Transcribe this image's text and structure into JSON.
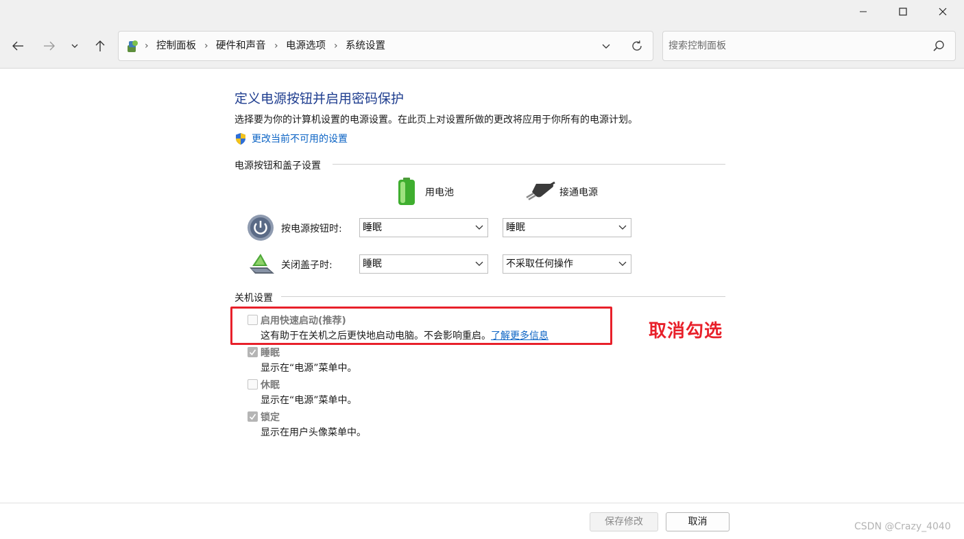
{
  "address": {
    "crumbs": [
      "控制面板",
      "硬件和声音",
      "电源选项",
      "系统设置"
    ],
    "separator": "›"
  },
  "search": {
    "placeholder": "搜索控制面板"
  },
  "icons": {
    "back": "back-arrow-icon",
    "forward": "forward-arrow-icon",
    "recent": "chevron-down-icon",
    "up": "up-arrow-icon",
    "refresh": "refresh-icon",
    "search": "search-icon",
    "minimize": "minimize-icon",
    "maximize": "maximize-icon",
    "close": "close-icon"
  },
  "page": {
    "title": "定义电源按钮并启用密码保护",
    "description": "选择要为你的计算机设置的电源设置。在此页上对设置所做的更改将应用于你所有的电源计划。",
    "change_link": "更改当前不可用的设置"
  },
  "power_section": {
    "heading": "电源按钮和盖子设置",
    "col_battery": "用电池",
    "col_plugged": "接通电源",
    "rows": [
      {
        "label": "按电源按钮时:",
        "battery": "睡眠",
        "plugged": "睡眠"
      },
      {
        "label": "关闭盖子时:",
        "battery": "睡眠",
        "plugged": "不采取任何操作"
      }
    ]
  },
  "shutdown_section": {
    "heading": "关机设置",
    "items": [
      {
        "label": "启用快速启动(推荐)",
        "desc": "这有助于在关机之后更快地启动电脑。不会影响重启。",
        "link": "了解更多信息",
        "checked": false
      },
      {
        "label": "睡眠",
        "desc": "显示在“电源”菜单中。",
        "checked": true
      },
      {
        "label": "休眠",
        "desc": "显示在“电源”菜单中。",
        "checked": false
      },
      {
        "label": "锁定",
        "desc": "显示在用户头像菜单中。",
        "checked": true
      }
    ]
  },
  "annotation": {
    "text": "取消勾选",
    "color": "#e8202a"
  },
  "footer": {
    "save": "保存修改",
    "cancel": "取消"
  },
  "watermark": "CSDN @Crazy_4040",
  "colors": {
    "title": "#1e3d8f",
    "link": "#0b63c4",
    "highlight": "#e8202a"
  }
}
